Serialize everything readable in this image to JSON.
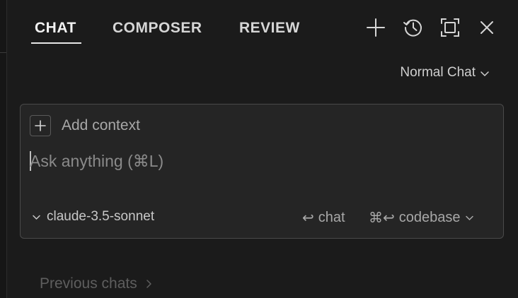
{
  "tabs": {
    "chat": "CHAT",
    "composer": "COMPOSER",
    "review": "REVIEW"
  },
  "toolbar": {
    "icons": [
      "plus-icon",
      "history-icon",
      "maximize-icon",
      "close-icon"
    ]
  },
  "mode": {
    "label": "Normal Chat"
  },
  "input": {
    "add_context_label": "Add context",
    "placeholder": "Ask anything (⌘L)",
    "value": ""
  },
  "footer": {
    "model": "claude-3.5-sonnet",
    "send_chat_kbd": "↩",
    "send_chat_label": "chat",
    "send_codebase_kbd": "⌘↩",
    "send_codebase_label": "codebase"
  },
  "previous_chats": {
    "label": "Previous chats"
  },
  "colors": {
    "background": "#1b1b1b",
    "input_background": "#252525",
    "border": "#4a4a4a",
    "text_primary": "#d6d6d6",
    "text_muted": "#a8a8a8"
  }
}
